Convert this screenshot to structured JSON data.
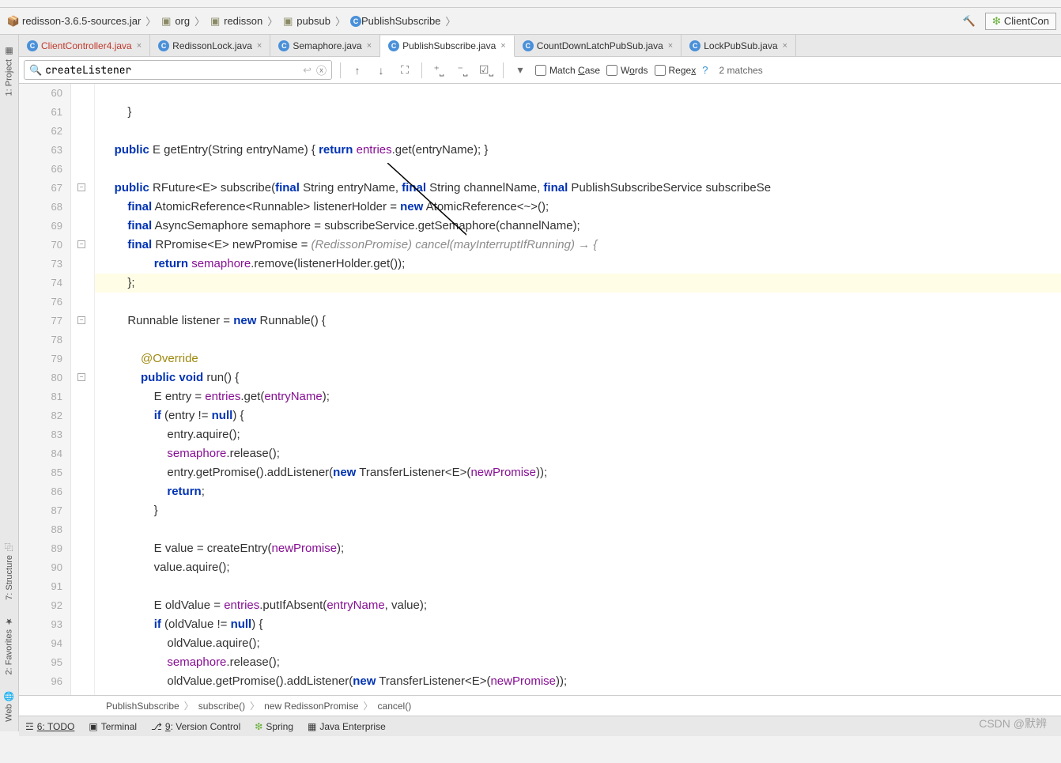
{
  "nav": {
    "jar": "redisson-3.6.5-sources.jar",
    "pkg1": "org",
    "pkg2": "redisson",
    "pkg3": "pubsub",
    "file": "PublishSubscribe",
    "config": "ClientCon"
  },
  "tabs": [
    {
      "label": "ClientController4.java"
    },
    {
      "label": "RedissonLock.java"
    },
    {
      "label": "Semaphore.java"
    },
    {
      "label": "PublishSubscribe.java",
      "active": true
    },
    {
      "label": "CountDownLatchPubSub.java"
    },
    {
      "label": "LockPubSub.java"
    }
  ],
  "find": {
    "value": "createListener",
    "match_case": "Match Case",
    "words": "Words",
    "regex": "Regex",
    "result": "2 matches"
  },
  "rail": {
    "project": "1: Project",
    "structure": "7: Structure",
    "favorites": "2: Favorites",
    "web": "Web"
  },
  "gutter": [
    "60",
    "61",
    "62",
    "63",
    "66",
    "67",
    "68",
    "69",
    "70",
    "73",
    "74",
    "76",
    "77",
    "78",
    "79",
    "80",
    "81",
    "82",
    "83",
    "84",
    "85",
    "86",
    "87",
    "88",
    "89",
    "90",
    "91",
    "92",
    "93",
    "94",
    "95",
    "96"
  ],
  "code": {
    "l61": "        }",
    "l63a": "    ",
    "l63kw1": "public",
    "l63b": " E getEntry(String entryName) { ",
    "l63kw2": "return",
    "l63c": " ",
    "l63f": "entries",
    "l63d": ".get(entryName); }",
    "l67a": "    ",
    "l67kw1": "public",
    "l67b": " RFuture<E> subscribe(",
    "l67kw2": "final",
    "l67c": " String entryName, ",
    "l67kw3": "final",
    "l67d": " String channelName, ",
    "l67kw4": "final",
    "l67e": " PublishSubscribeService subscribeSe",
    "l68a": "        ",
    "l68kw": "final",
    "l68b": " AtomicReference<Runnable> listenerHolder = ",
    "l68kw2": "new",
    "l68c": " AtomicReference<~>();",
    "l69a": "        ",
    "l69kw": "final",
    "l69b": " AsyncSemaphore semaphore = subscribeService.getSemaphore(channelName);",
    "l70a": "        ",
    "l70kw": "final",
    "l70b": " RPromise<E> newPromise = ",
    "l70c": "(RedissonPromise) cancel(mayInterruptIfRunning) → {",
    "l73a": "                ",
    "l73kw": "return",
    "l73b": " ",
    "l73f": "semaphore",
    "l73c": ".remove(listenerHolder.get());",
    "l74": "        };",
    "l77a": "        Runnable listener = ",
    "l77kw": "new",
    "l77b": " Runnable() {",
    "l79a": "            ",
    "l79ann": "@Override",
    "l80a": "            ",
    "l80kw1": "public",
    "l80b": " ",
    "l80kw2": "void",
    "l80c": " run() {",
    "l81a": "                E entry = ",
    "l81f": "entries",
    "l81b": ".get(",
    "l81p": "entryName",
    "l81c": ");",
    "l82a": "                ",
    "l82kw": "if",
    "l82b": " (entry != ",
    "l82kw2": "null",
    "l82c": ") {",
    "l83": "                    entry.aquire();",
    "l84a": "                    ",
    "l84f": "semaphore",
    "l84b": ".release();",
    "l85a": "                    entry.getPromise().addListener(",
    "l85kw": "new",
    "l85b": " TransferListener<E>(",
    "l85p": "newPromise",
    "l85c": "));",
    "l86a": "                    ",
    "l86kw": "return",
    "l86b": ";",
    "l87": "                }",
    "l89a": "                E value = createEntry(",
    "l89p": "newPromise",
    "l89b": ");",
    "l90": "                value.aquire();",
    "l92a": "                E oldValue = ",
    "l92f": "entries",
    "l92b": ".putIfAbsent(",
    "l92p": "entryName",
    "l92c": ", value);",
    "l93a": "                ",
    "l93kw": "if",
    "l93b": " (oldValue != ",
    "l93kw2": "null",
    "l93c": ") {",
    "l94": "                    oldValue.aquire();",
    "l95a": "                    ",
    "l95f": "semaphore",
    "l95b": ".release();",
    "l96a": "                    oldValue.getPromise().addListener(",
    "l96kw": "new",
    "l96b": " TransferListener<E>(",
    "l96p": "newPromise",
    "l96c": "));"
  },
  "breadcrumb": {
    "a": "PublishSubscribe",
    "b": "subscribe()",
    "c": "new RedissonPromise",
    "d": "cancel()"
  },
  "bottom": {
    "todo": "6: TODO",
    "term": "Terminal",
    "vc": "9: Version Control",
    "spring": "Spring",
    "jee": "Java Enterprise"
  },
  "watermark": "CSDN @默辨"
}
